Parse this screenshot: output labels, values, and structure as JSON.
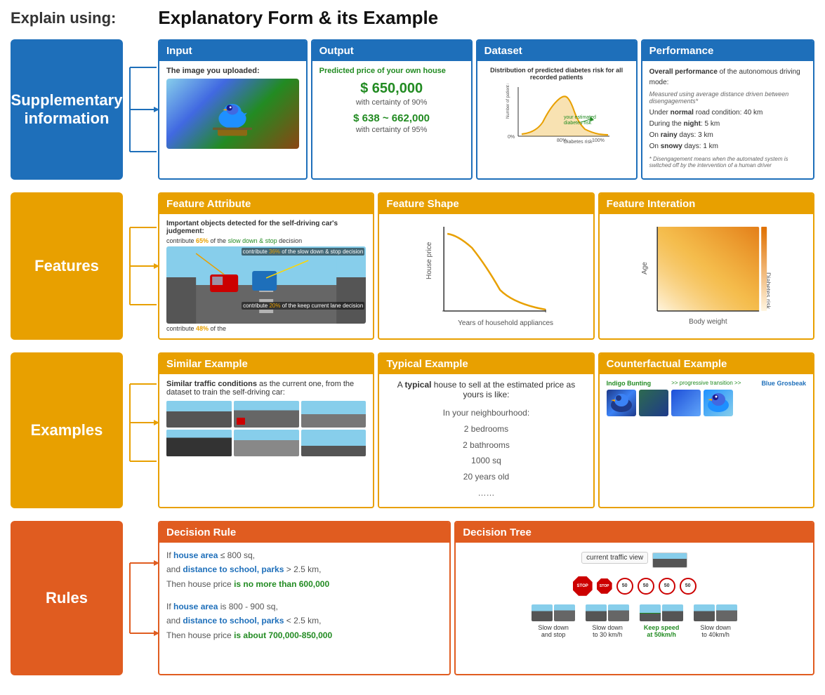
{
  "header": {
    "explain_label": "Explain using:",
    "form_title": "Explanatory Form & its Example"
  },
  "row1": {
    "category": "Supplementary information",
    "panels": {
      "input": {
        "header": "Input",
        "body_label": "The image you uploaded:"
      },
      "output": {
        "header": "Output",
        "predicted_label": "Predicted price of your own house",
        "price_main": "$ 650,000",
        "certainty_main": "with certainty of 90%",
        "price_range": "$ 638 ~ 662,000",
        "certainty_range": "with certainty of 95%"
      },
      "dataset": {
        "header": "Dataset",
        "title": "Distribution of predicted diabetes risk for all recorded patients",
        "x_label": "Diabetes risk",
        "y_label": "Number of patient records",
        "annotation": "your estimated diabetes risk"
      },
      "performance": {
        "header": "Performance",
        "title": "Overall performance of the autonomous driving mode:",
        "subtitle": "Measured using average distance driven between disengagements*",
        "items": [
          "Under normal road condition: 40 km",
          "During the night: 5 km",
          "On rainy days: 3 km",
          "On snowy days: 1 km"
        ],
        "footnote": "* Disengagement means when the automated system is switched off by the intervention of a human driver"
      }
    }
  },
  "row2": {
    "category": "Features",
    "panels": {
      "feature_attribute": {
        "header": "Feature Attribute",
        "title": "Important objects detected for the self-driving car's judgement:",
        "annotations": [
          "contribute 65% of the slow down & stop decision",
          "contribute 36% of the slow down & stop decision",
          "contribute 20% of the keep current lane decision",
          "contribute 48% of the"
        ]
      },
      "feature_shape": {
        "header": "Feature Shape",
        "x_label": "Years of household appliances",
        "y_label": "House price",
        "note": "1 Years of household appliances"
      },
      "feature_interaction": {
        "header": "Feature Interation",
        "x_label": "Body weight",
        "y_label": "Age",
        "z_label": "Diabetes risk"
      }
    }
  },
  "row3": {
    "category": "Examples",
    "panels": {
      "similar": {
        "header": "Similar Example",
        "text": "Similar traffic conditions as the current one, from the dataset to train the self-driving car:"
      },
      "typical": {
        "header": "Typical Example",
        "intro": "A typical house to sell at the estimated price as yours is like:",
        "items": [
          "In your neighbourhood:",
          "2 bedrooms",
          "2 bathrooms",
          "1000 sq",
          "20 years old",
          "……"
        ]
      },
      "counterfactual": {
        "header": "Counterfactual Example",
        "label1": "Indigo Bunting",
        "arrow": ">> progressive transition >>",
        "label2": "Blue Grosbeak"
      }
    }
  },
  "row4": {
    "category": "Rules",
    "panels": {
      "decision_rule": {
        "header": "Decision Rule",
        "rules": [
          {
            "condition1": "If house area ≤ 800 sq,",
            "condition2": "and distance to school, parks > 2.5 km,",
            "result": "Then house price is no more than 600,000"
          },
          {
            "condition1": "If house area is 800 - 900 sq,",
            "condition2": "and distance to school, parks < 2.5 km,",
            "result": "Then house price is about 700,000-850,000"
          }
        ]
      },
      "decision_tree": {
        "header": "Decision Tree",
        "traffic_label": "current traffic view",
        "actions": [
          "Slow down\nand stop",
          "Slow down\nto 30 km/h",
          "Keep speed\nat 50km/h",
          "Slow down\nto 40km/h"
        ]
      }
    }
  }
}
